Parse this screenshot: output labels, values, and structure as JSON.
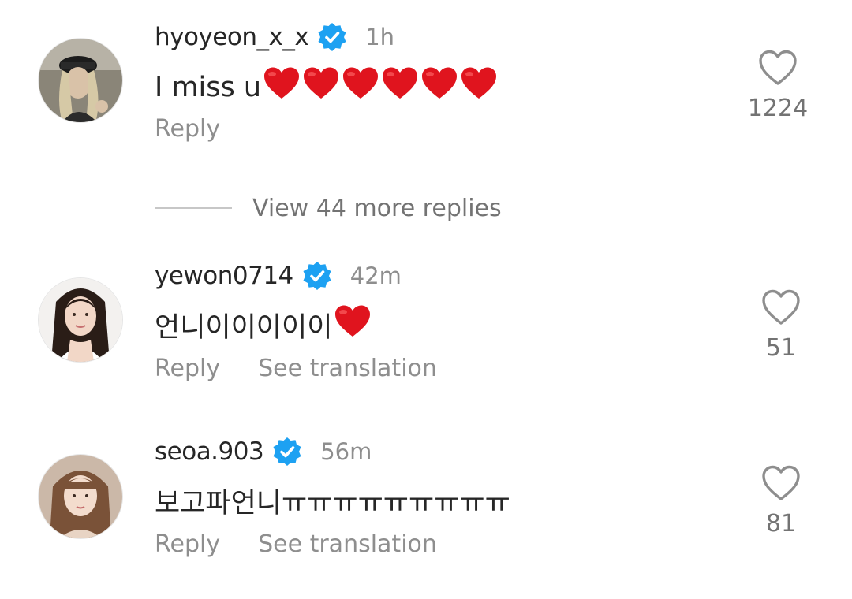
{
  "colors": {
    "verified_blue": "#1DA1F2",
    "heart_red": "#E0141E",
    "muted_text": "#8E8E8E",
    "primary_text": "#262626"
  },
  "comments": [
    {
      "username": "hyoyeon_x_x",
      "verified": true,
      "time": "1h",
      "text": "I miss u",
      "emoji_hearts": 6,
      "reply_label": "Reply",
      "like_count": "1224",
      "avatar_icon": "avatar-photo"
    },
    {
      "username": "yewon0714",
      "verified": true,
      "time": "42m",
      "text": "언니이이이이이",
      "emoji_hearts": 1,
      "reply_label": "Reply",
      "translate_label": "See translation",
      "like_count": "51",
      "avatar_icon": "avatar-photo"
    },
    {
      "username": "seoa.903",
      "verified": true,
      "time": "56m",
      "text": "보고파언니ㅠㅠㅠㅠㅠㅠㅠㅠㅠ",
      "emoji_hearts": 0,
      "reply_label": "Reply",
      "translate_label": "See translation",
      "like_count": "81",
      "avatar_icon": "avatar-photo"
    }
  ],
  "view_replies": {
    "label": "View 44 more replies"
  }
}
